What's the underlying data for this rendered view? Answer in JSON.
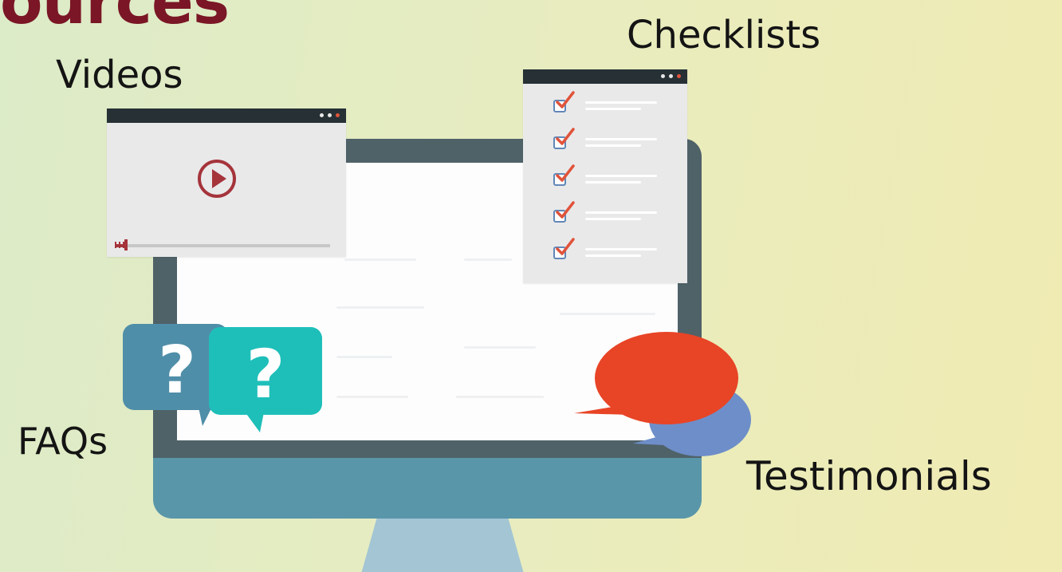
{
  "title": "ources",
  "labels": {
    "videos": "Videos",
    "checklists": "Checklists",
    "faqs": "FAQs",
    "testimonials": "Testimonials"
  },
  "faq_bubbles": [
    "?",
    "?"
  ],
  "colors": {
    "title": "#7a1626",
    "monitor_bezel": "#4f6268",
    "monitor_chin": "#5a96a9",
    "accent_red": "#e0533a",
    "video_red": "#a5343b",
    "faq_blue": "#4f8ea8",
    "faq_teal": "#1fbfb9",
    "testimonial_red": "#e84426",
    "testimonial_blue": "#6e8ec9",
    "checkbox_blue": "#6187b8"
  },
  "icons": {
    "video": "play-icon",
    "checklist": "checkbox-checked-icon",
    "faq": "question-bubble-icon",
    "testimonial": "speech-bubble-icon"
  },
  "video": {
    "progress": 0.05
  },
  "checklist_items": 5
}
